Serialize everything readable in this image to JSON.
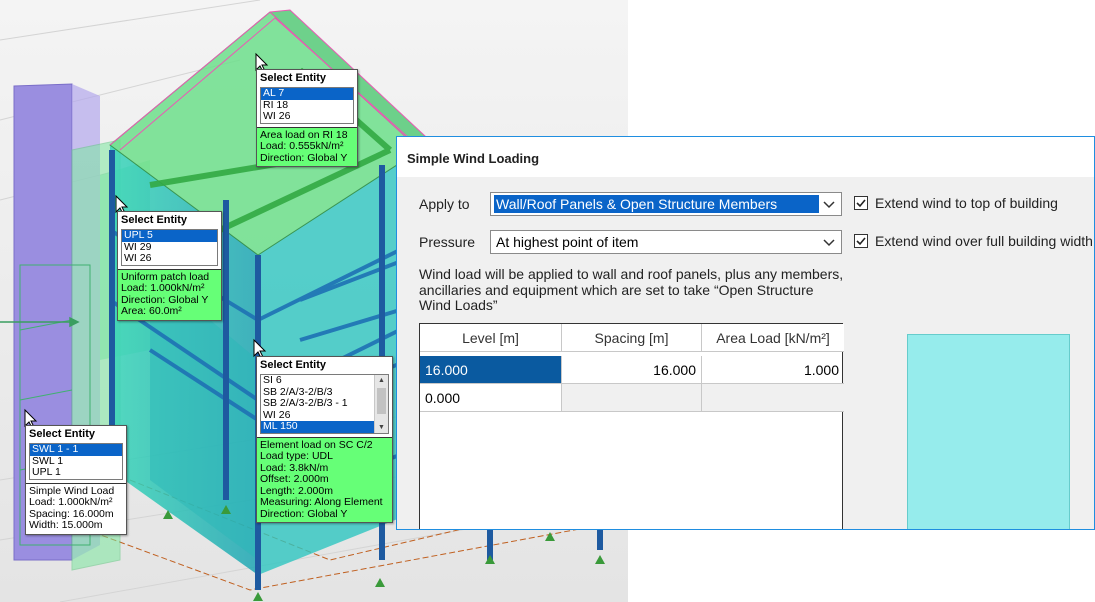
{
  "tooltips": {
    "roof": {
      "header": "Select Entity",
      "items": [
        "AL 7",
        "RI 18",
        "WI 26"
      ],
      "selected": 0,
      "info": [
        "Area load on RI 18",
        "Load: 0.555kN/m²",
        "Direction: Global Y"
      ]
    },
    "patch": {
      "header": "Select Entity",
      "items": [
        "UPL 5",
        "WI 29",
        "WI 26"
      ],
      "selected": 0,
      "info": [
        "Uniform patch load",
        "Load: 1.000kN/m²",
        "Direction: Global Y",
        "Area: 60.0m²"
      ]
    },
    "element": {
      "header": "Select Entity",
      "items": [
        "SI 6",
        "SB 2/A/3-2/B/3",
        "SB 2/A/3-2/B/3 - 1",
        "WI 26",
        "ML 150"
      ],
      "selected": 4,
      "info": [
        "Element load on SC C/2",
        "Load type: UDL",
        "Load: 3.8kN/m",
        "Offset: 2.000m",
        "Length: 2.000m",
        "Measuring: Along Element",
        "Direction: Global Y"
      ]
    },
    "wind": {
      "header": "Select Entity",
      "items": [
        "SWL 1 - 1",
        "SWL 1",
        "UPL 1"
      ],
      "selected": 0,
      "info": [
        "Simple Wind Load",
        "Load: 1.000kN/m²",
        "Spacing: 16.000m",
        "Width: 15.000m"
      ]
    }
  },
  "dialog": {
    "title": "Simple Wind Loading",
    "apply_to_label": "Apply to",
    "apply_to_value": "Wall/Roof Panels & Open Structure Members",
    "pressure_label": "Pressure",
    "pressure_value": "At highest point of item",
    "extend_top_label": "Extend wind to top of building",
    "extend_top_checked": true,
    "extend_full_label": "Extend wind over full building width",
    "extend_full_checked": true,
    "note": "Wind load will be applied to wall and roof panels, plus any members, ancillaries and equipment which are set to take “Open Structure Wind Loads”",
    "table": {
      "columns": [
        "Level [m]",
        "Spacing [m]",
        "Area Load [kN/m²]"
      ],
      "rows": [
        {
          "level": "16.000",
          "spacing": "16.000",
          "area_load": "1.000"
        },
        {
          "level": "0.000",
          "spacing": "",
          "area_load": ""
        }
      ]
    }
  },
  "colors": {
    "selection": "#0a64c8",
    "info_bg": "#66ff77",
    "panel": "#3cc8b4",
    "member": "#1e5aa0",
    "preview": "#96ecec"
  }
}
